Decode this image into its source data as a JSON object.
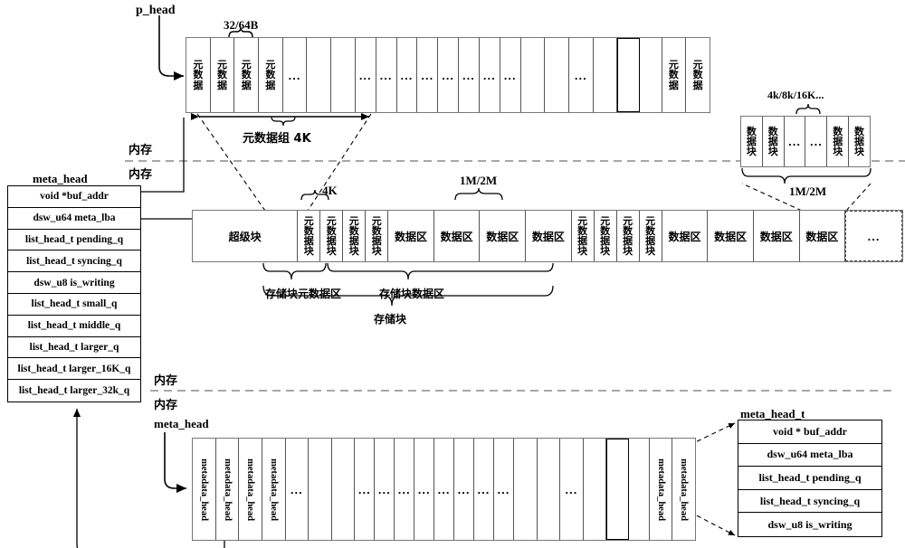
{
  "labels": {
    "p_head": "p_head",
    "size_32_64B": "32/64B",
    "meta_group_4K": "元数据组 4K",
    "mem_upper": "内存",
    "mem_lower": "内存",
    "size_4K": "4K",
    "size_1M_2M": "1M/2M",
    "size_4k8k16k": "4k/8k/16K...",
    "size_1M_2M_right": "1M/2M",
    "blk_meta_area": "存储块元数据区",
    "blk_data_area": "存储块数据区",
    "blk_whole": "存储块",
    "mem_bottom_upper": "内存",
    "mem_bottom_lower": "内存",
    "meta_head_ptr": "meta_head",
    "meta_head_title": "meta_head",
    "meta_head_t_title": "meta_head_t"
  },
  "meta_head_struct": {
    "title": "meta_head",
    "fields": [
      "void *buf_addr",
      "dsw_u64 meta_lba",
      "list_head_t pending_q",
      "list_head_t syncing_q",
      "dsw_u8 is_writing",
      "list_head_t small_q",
      "list_head_t middle_q",
      "list_head_t larger_q",
      "list_head_t larger_16K_q",
      "list_head_t larger_32k_q"
    ]
  },
  "meta_head_t_struct": {
    "title": "meta_head_t",
    "fields": [
      "void * buf_addr",
      "dsw_u64 meta_lba",
      "list_head_t pending_q",
      "list_head_t syncing_q",
      "dsw_u8 is_writing"
    ]
  },
  "top_row": {
    "name": "metadata-array",
    "cells": [
      {
        "t": "元数据",
        "k": "cn"
      },
      {
        "t": "元数据",
        "k": "cn"
      },
      {
        "t": "元数据",
        "k": "cn"
      },
      {
        "t": "元数据",
        "k": "cn"
      },
      {
        "t": "...",
        "k": "dots"
      },
      {
        "t": "",
        "k": "blank"
      },
      {
        "t": "",
        "k": "blank"
      },
      {
        "t": "...",
        "k": "dots"
      },
      {
        "t": "...",
        "k": "dots"
      },
      {
        "t": "...",
        "k": "dots"
      },
      {
        "t": "...",
        "k": "dots"
      },
      {
        "t": "...",
        "k": "dots"
      },
      {
        "t": "...",
        "k": "dots"
      },
      {
        "t": "...",
        "k": "dots"
      },
      {
        "t": "...",
        "k": "dots"
      },
      {
        "t": "",
        "k": "blank"
      },
      {
        "t": "",
        "k": "blank"
      },
      {
        "t": "...",
        "k": "dots"
      },
      {
        "t": "",
        "k": "blank"
      },
      {
        "t": "",
        "k": "thick"
      },
      {
        "t": "",
        "k": "blank"
      },
      {
        "t": "元数据",
        "k": "cn"
      },
      {
        "t": "元数据",
        "k": "cn"
      }
    ]
  },
  "mid_row": {
    "name": "storage-block-layout",
    "cells": [
      {
        "t": "超级块",
        "k": "wide"
      },
      {
        "t": "元数据块",
        "k": "cn"
      },
      {
        "t": "元数据块",
        "k": "cn"
      },
      {
        "t": "元数据块",
        "k": "cn"
      },
      {
        "t": "元数据块",
        "k": "cn"
      },
      {
        "t": "数据区",
        "k": "area"
      },
      {
        "t": "数据区",
        "k": "area"
      },
      {
        "t": "数据区",
        "k": "area"
      },
      {
        "t": "数据区",
        "k": "area"
      },
      {
        "t": "元数据块",
        "k": "cn"
      },
      {
        "t": "元数据块",
        "k": "cn"
      },
      {
        "t": "元数据块",
        "k": "cn"
      },
      {
        "t": "元数据块",
        "k": "cn"
      },
      {
        "t": "数据区",
        "k": "area"
      },
      {
        "t": "数据区",
        "k": "area"
      },
      {
        "t": "数据区",
        "k": "area"
      },
      {
        "t": "数据区",
        "k": "area"
      },
      {
        "t": "...",
        "k": "dashdots"
      }
    ]
  },
  "right_row": {
    "name": "data-block-array",
    "cells": [
      {
        "t": "数据块",
        "k": "cn"
      },
      {
        "t": "数据块",
        "k": "cn"
      },
      {
        "t": "...",
        "k": "dots"
      },
      {
        "t": "...",
        "k": "dots"
      },
      {
        "t": "数据块",
        "k": "cn"
      },
      {
        "t": "数据块",
        "k": "cn"
      }
    ]
  },
  "bottom_row": {
    "name": "metadata-head-array",
    "cells": [
      {
        "t": "metadata_head",
        "k": "vlat"
      },
      {
        "t": "metadata_head",
        "k": "vlat"
      },
      {
        "t": "metadata_head",
        "k": "vlat"
      },
      {
        "t": "metadata_head",
        "k": "vlat"
      },
      {
        "t": "...",
        "k": "dots"
      },
      {
        "t": "",
        "k": "blank"
      },
      {
        "t": "",
        "k": "blank"
      },
      {
        "t": "...",
        "k": "dots"
      },
      {
        "t": "...",
        "k": "dots"
      },
      {
        "t": "...",
        "k": "dots"
      },
      {
        "t": "...",
        "k": "dots"
      },
      {
        "t": "...",
        "k": "dots"
      },
      {
        "t": "...",
        "k": "dots"
      },
      {
        "t": "...",
        "k": "dots"
      },
      {
        "t": "...",
        "k": "dots"
      },
      {
        "t": "",
        "k": "blank"
      },
      {
        "t": "",
        "k": "blank"
      },
      {
        "t": "...",
        "k": "dots"
      },
      {
        "t": "",
        "k": "blank"
      },
      {
        "t": "",
        "k": "thick"
      },
      {
        "t": "",
        "k": "blank"
      },
      {
        "t": "metadata_head",
        "k": "vlat"
      },
      {
        "t": "metadata_head",
        "k": "vlat"
      }
    ]
  },
  "colors": {
    "line": "#000000",
    "cell_border": "#555555",
    "dashed": "#777777",
    "bg": "#ffffff"
  }
}
